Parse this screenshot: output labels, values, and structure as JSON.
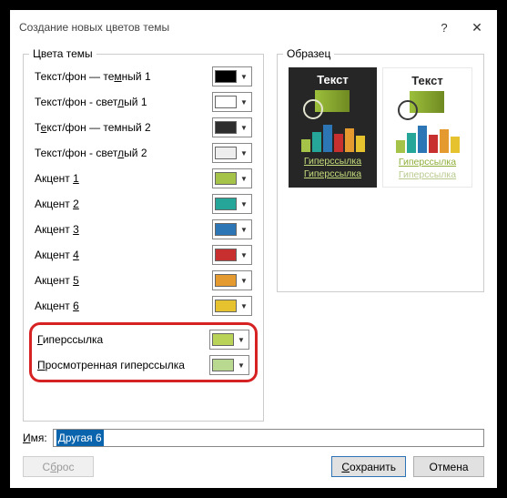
{
  "title": "Создание новых цветов темы",
  "fieldset_left": "Цвета темы",
  "fieldset_right": "Образец",
  "rows": [
    {
      "pre": "Текст/фон — те",
      "u": "м",
      "post": "ный 1",
      "color": "#000000"
    },
    {
      "pre": "Текст/фон - свет",
      "u": "л",
      "post": "ый 1",
      "color": "#ffffff"
    },
    {
      "pre": "Т",
      "u": "е",
      "post": "кст/фон — темный 2",
      "color": "#2e2e2e"
    },
    {
      "pre": "Текст/фон - свет",
      "u": "л",
      "post": "ый 2",
      "color": "#eeeeee"
    },
    {
      "pre": "Акцент ",
      "u": "1",
      "post": "",
      "color": "#a5c249"
    },
    {
      "pre": "Акцент ",
      "u": "2",
      "post": "",
      "color": "#26a699"
    },
    {
      "pre": "Акцент ",
      "u": "3",
      "post": "",
      "color": "#2d76b5"
    },
    {
      "pre": "Акцент ",
      "u": "4",
      "post": "",
      "color": "#c82f2f"
    },
    {
      "pre": "Акцент ",
      "u": "5",
      "post": "",
      "color": "#e59a2f"
    },
    {
      "pre": "Акцент ",
      "u": "6",
      "post": "",
      "color": "#e6c22f"
    }
  ],
  "hyperlink_row": {
    "pre": "",
    "u": "Г",
    "post": "иперссылка",
    "color": "#b8d358"
  },
  "followed_row": {
    "pre": "",
    "u": "П",
    "post": "росмотренная гиперссылка",
    "color": "#b8d98f"
  },
  "preview": {
    "text_label": "Текст",
    "hyperlink": "Гиперссылка",
    "followed": "Гиперссылка",
    "bars": [
      "#a5c249",
      "#26a699",
      "#2d76b5",
      "#c82f2f",
      "#e59a2f",
      "#e6c22f"
    ],
    "link_color_dark": "#c6de7c",
    "followed_color_dark": "#c6de7c",
    "link_color_light": "#8fae3a",
    "followed_color_light": "#b9ca8f"
  },
  "name_label_pre": "",
  "name_label_u": "И",
  "name_label_post": "мя:",
  "name_value": "Другая 6",
  "btn_reset_pre": "С",
  "btn_reset_u": "б",
  "btn_reset_post": "рос",
  "btn_save_pre": "",
  "btn_save_u": "С",
  "btn_save_post": "охранить",
  "btn_cancel": "Отмена"
}
